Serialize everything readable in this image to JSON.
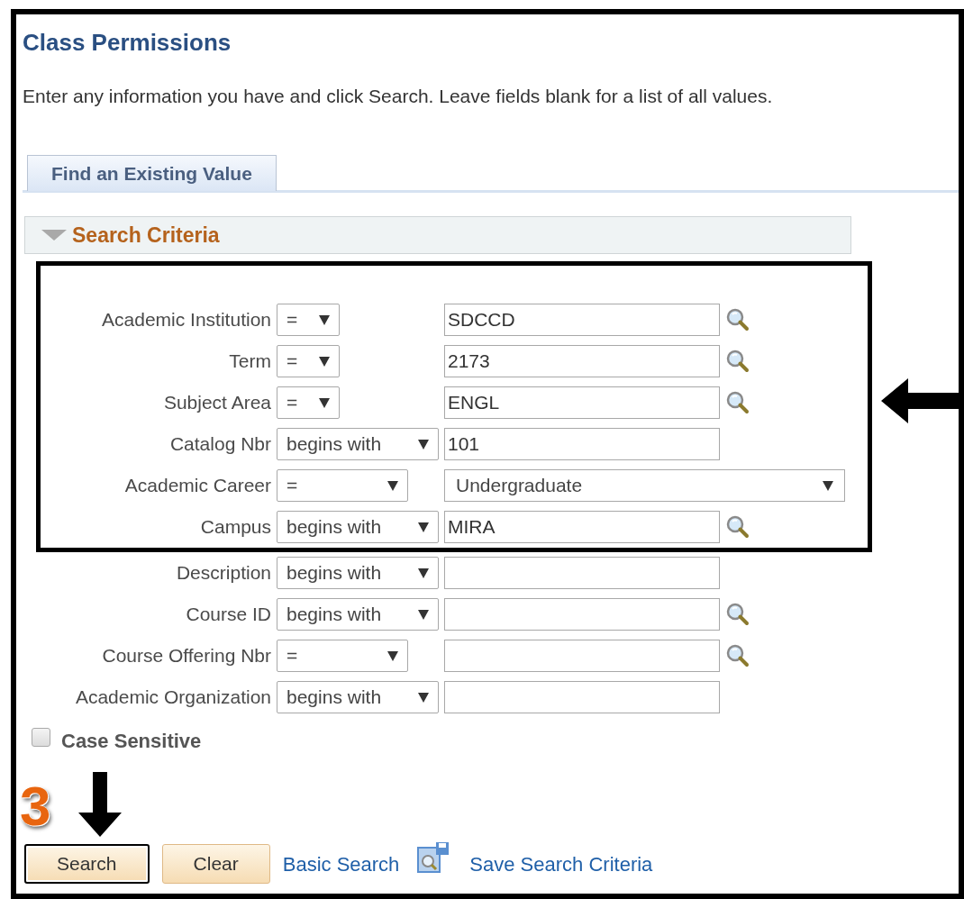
{
  "page": {
    "title": "Class Permissions",
    "instructions": "Enter any information you have and click Search. Leave fields blank for a list of all values."
  },
  "tabs": [
    {
      "label": "Find an Existing Value",
      "selected": true
    }
  ],
  "search_criteria": {
    "title": "Search Criteria",
    "expanded": true,
    "fields": [
      {
        "label": "Academic Institution",
        "operator": {
          "kind": "narrow",
          "value": "="
        },
        "value": "SDCCD",
        "kind": "lookup",
        "highlighted": true
      },
      {
        "label": "Term",
        "operator": {
          "kind": "narrow",
          "value": "="
        },
        "value": "2173",
        "kind": "lookup",
        "highlighted": true
      },
      {
        "label": "Subject Area",
        "operator": {
          "kind": "narrow",
          "value": "="
        },
        "value": "ENGL",
        "kind": "lookup",
        "highlighted": true
      },
      {
        "label": "Catalog Nbr",
        "operator": {
          "kind": "wide",
          "value": "begins with"
        },
        "value": "101",
        "kind": "text",
        "highlighted": true
      },
      {
        "label": "Academic Career",
        "operator": {
          "kind": "medium",
          "value": "="
        },
        "value": "Undergraduate",
        "kind": "dropdown",
        "highlighted": true
      },
      {
        "label": "Campus",
        "operator": {
          "kind": "wide",
          "value": "begins with"
        },
        "value": "MIRA",
        "kind": "lookup",
        "highlighted": true
      },
      {
        "label": "Description",
        "operator": {
          "kind": "wide",
          "value": "begins with"
        },
        "kind": "text",
        "highlighted": false
      },
      {
        "label": "Course ID",
        "operator": {
          "kind": "wide",
          "value": "begins with"
        },
        "kind": "lookup",
        "highlighted": false
      },
      {
        "label": "Course Offering Nbr",
        "operator": {
          "kind": "medium",
          "value": "="
        },
        "kind": "lookup",
        "highlighted": false
      },
      {
        "label": "Academic Organization",
        "operator": {
          "kind": "wide",
          "value": "begins with"
        },
        "kind": "text",
        "highlighted": false
      }
    ]
  },
  "case_sensitive": {
    "label": "Case Sensitive",
    "checked": false
  },
  "actions": [
    {
      "kind": "button",
      "label": "Search",
      "focused": true
    },
    {
      "kind": "button",
      "label": "Clear",
      "focused": false
    },
    {
      "kind": "link",
      "label": "Basic Search"
    },
    {
      "kind": "icon-link",
      "label": "Save Search Criteria"
    }
  ],
  "annotation": {
    "step": "3"
  }
}
